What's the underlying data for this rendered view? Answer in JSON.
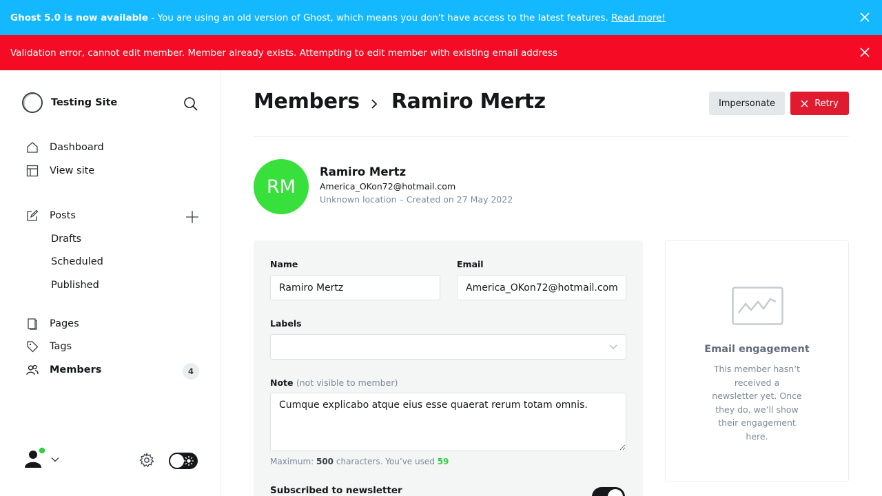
{
  "upgrade_banner": {
    "title": "Ghost 5.0 is now available",
    "message": " - You are using an old version of Ghost, which means you don't have access to the latest features. ",
    "link": "Read more!"
  },
  "error_banner": {
    "message": "Validation error, cannot edit member. Member already exists. Attempting to edit member with existing email address"
  },
  "sidebar": {
    "site_title": "Testing Site",
    "nav": {
      "dashboard": "Dashboard",
      "view_site": "View site",
      "posts": "Posts",
      "drafts": "Drafts",
      "scheduled": "Scheduled",
      "published": "Published",
      "pages": "Pages",
      "tags": "Tags",
      "members": "Members",
      "members_count": "4"
    },
    "icons": [
      "home-icon",
      "view-site-icon",
      "posts-icon",
      "pages-icon",
      "tags-icon",
      "members-icon",
      "search-icon",
      "plus-icon",
      "gear-icon",
      "sun-icon",
      "user-icon"
    ],
    "status_dot_color": "#30cf43"
  },
  "header": {
    "breadcrumb_parent": "Members",
    "breadcrumb_current": "Ramiro Mertz",
    "impersonate_label": "Impersonate",
    "retry_label": "Retry"
  },
  "member": {
    "initials": "RM",
    "name": "Ramiro Mertz",
    "email": "America_OKon72@hotmail.com",
    "meta": "Unknown location – Created on 27 May 2022",
    "avatar_color": "#37e03a"
  },
  "form": {
    "name_label": "Name",
    "name_value": "Ramiro Mertz",
    "email_label": "Email",
    "email_value": "America_OKon72@hotmail.com",
    "labels_label": "Labels",
    "note_label": "Note",
    "note_hint": "(not visible to member)",
    "note_value": "Cumque explicabo atque eius esse quaerat rerum totam omnis.",
    "counter_prefix": "Maximum: ",
    "counter_max": "500",
    "counter_middle": " characters. You’ve used ",
    "counter_used": "59",
    "newsletter_label": "Subscribed to newsletter",
    "newsletter_subscribed": true
  },
  "engagement": {
    "title": "Email engagement",
    "description": "This member hasn’t received a newsletter yet. Once they do, we’ll show their engagement here."
  },
  "colors": {
    "upgrade_banner": "#14b8ff",
    "error_banner": "#f50b23",
    "retry_button": "#e01b2f"
  }
}
